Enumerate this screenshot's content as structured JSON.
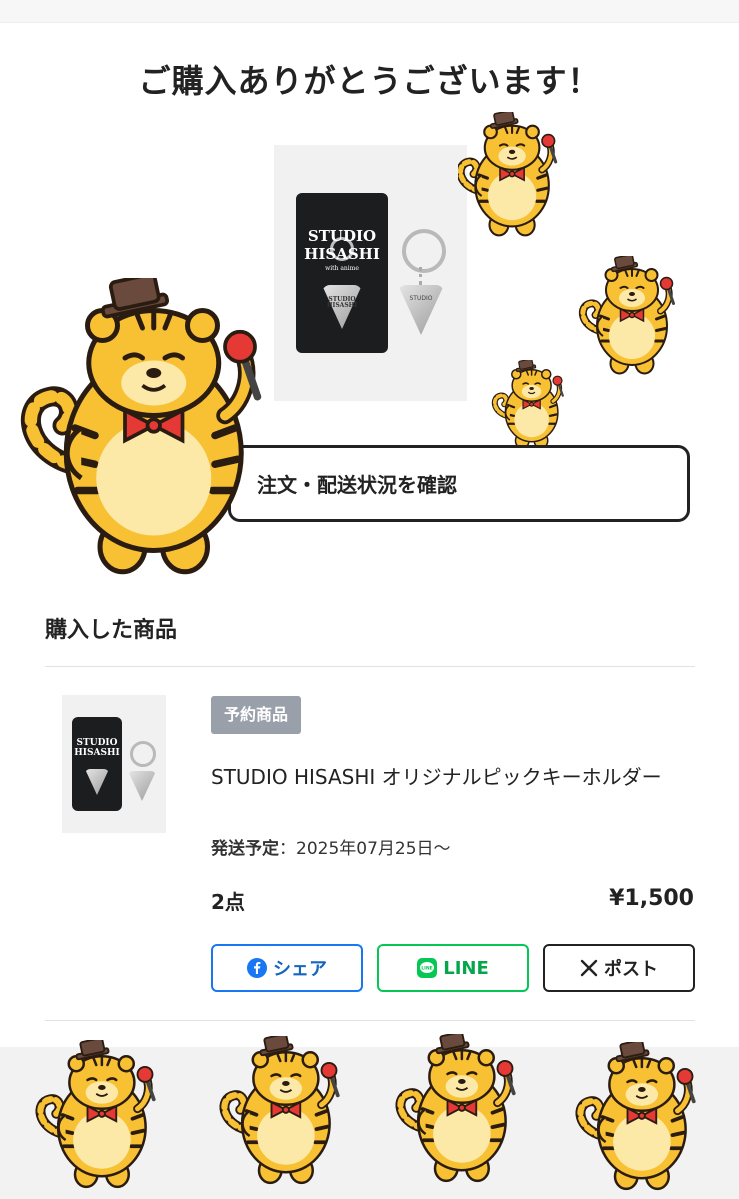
{
  "page": {
    "title": "ご購入ありがとうございます！"
  },
  "hero_image": {
    "card_line1": "STUDIO",
    "card_line2": "HISASHI",
    "card_sub": "with anime",
    "pick_card": "STUDIO HISASHI",
    "pick_keyring": "STUDIO"
  },
  "actions": {
    "confirm_label": "注文・配送状況を確認"
  },
  "purchased": {
    "section_title": "購入した商品",
    "badge": "予約商品",
    "product_name": "STUDIO HISASHI オリジナルピックキーホルダー",
    "ship_label": "発送予定",
    "ship_sep": "：",
    "ship_date": "2025年07月25日〜",
    "quantity": "2点",
    "price": "¥1,500"
  },
  "share": {
    "facebook_label": "シェア",
    "line_label": "LINE",
    "x_label": "ポスト"
  },
  "colors": {
    "tiger_body": "#f8c033",
    "tiger_belly": "#fde9a7",
    "bowtie": "#e53935",
    "hat": "#6a4a3c",
    "facebook": "#1877f2",
    "line": "#06c755"
  }
}
